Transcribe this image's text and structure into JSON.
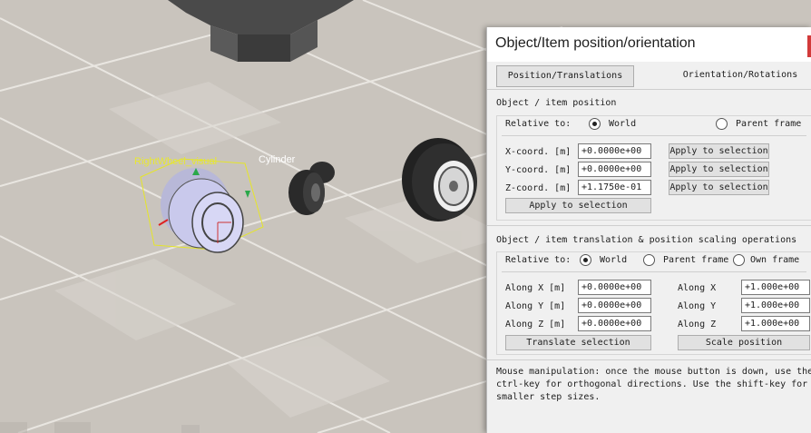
{
  "scene": {
    "object_label": "RightWheel_visual",
    "cylinder_label": "Cylinder"
  },
  "dialog": {
    "title": "Object/Item position/orientation",
    "tabs": [
      {
        "label": "Position/Translations",
        "active": true
      },
      {
        "label": "Orientation/Rotations",
        "active": false
      }
    ],
    "position_section": {
      "heading": "Object / item position",
      "relative_label": "Relative to:",
      "options": [
        {
          "label": "World",
          "selected": true
        },
        {
          "label": "Parent frame",
          "selected": false
        }
      ],
      "rows": [
        {
          "label": "X-coord. [m]",
          "value": "+0.0000e+00",
          "button": "Apply to selection"
        },
        {
          "label": "Y-coord. [m]",
          "value": "+0.0000e+00",
          "button": "Apply to selection"
        },
        {
          "label": "Z-coord. [m]",
          "value": "+1.1750e-01",
          "button": "Apply to selection"
        }
      ],
      "apply_all": "Apply to selection"
    },
    "translation_section": {
      "heading": "Object / item translation & position scaling operations",
      "relative_label": "Relative to:",
      "options": [
        {
          "label": "World",
          "selected": true
        },
        {
          "label": "Parent frame",
          "selected": false
        },
        {
          "label": "Own frame",
          "selected": false
        }
      ],
      "rows": [
        {
          "label": "Along X [m]",
          "value": "+0.0000e+00",
          "scale_label": "Along X",
          "scale_value": "+1.000e+00"
        },
        {
          "label": "Along Y [m]",
          "value": "+0.0000e+00",
          "scale_label": "Along Y",
          "scale_value": "+1.000e+00"
        },
        {
          "label": "Along Z [m]",
          "value": "+0.0000e+00",
          "scale_label": "Along Z",
          "scale_value": "+1.000e+00"
        }
      ],
      "translate_button": "Translate selection",
      "scale_button": "Scale position"
    },
    "footer_text": "Mouse manipulation: once the mouse button is down, use the ctrl-key for orthogonal directions. Use the shift-key for smaller step sizes."
  }
}
